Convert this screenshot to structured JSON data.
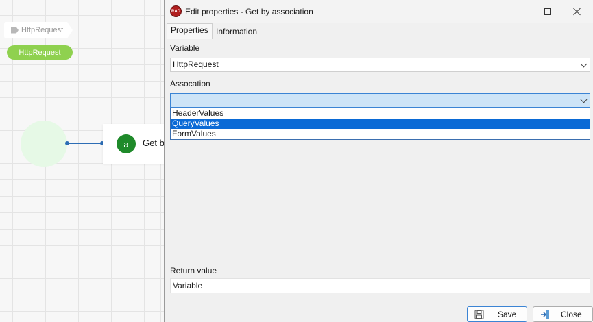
{
  "canvas": {
    "tag_label": "HttpRequest",
    "variable_pill": "HttpRequest",
    "action_badge": "a",
    "action_label": "Get b"
  },
  "dialog": {
    "app_icon_text": "RAD",
    "title": "Edit properties - Get by association",
    "tabs": [
      {
        "label": "Properties",
        "active": true
      },
      {
        "label": "Information",
        "active": false
      }
    ],
    "variable": {
      "label": "Variable",
      "value": "HttpRequest"
    },
    "association": {
      "label": "Assocation",
      "value": "",
      "options": [
        "HeaderValues",
        "QueryValues",
        "FormValues"
      ],
      "highlighted": "QueryValues"
    },
    "return_value": {
      "label": "Return value",
      "value": "Variable"
    },
    "buttons": {
      "save": "Save",
      "close": "Close"
    }
  },
  "colors": {
    "accent": "#0a6ad6",
    "pill_green": "#8fd14f",
    "badge_green": "#1f8a2a",
    "node_fill": "#e6f9e6",
    "connector_blue": "#2d6db5",
    "app_icon_red": "#b01e1e"
  },
  "icons": {
    "tag": "tag-icon",
    "save": "floppy-disk-icon",
    "close": "exit-arrow-icon",
    "dropdown": "chevron-down-icon"
  }
}
